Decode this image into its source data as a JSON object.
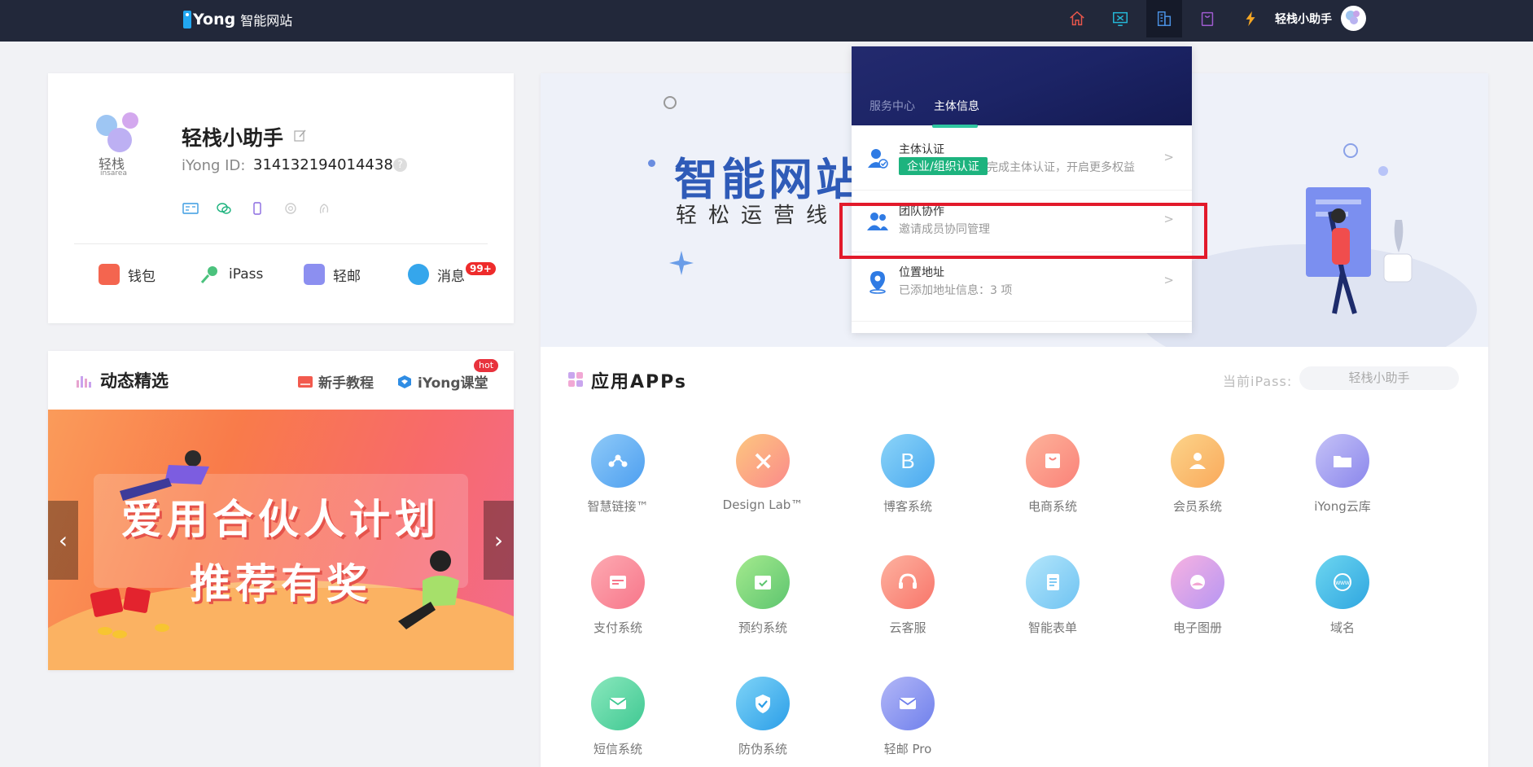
{
  "topbar": {
    "logo_word": "Yong",
    "logo_sub": "智能网站",
    "icons": [
      "home-icon",
      "monitor-icon",
      "building-icon",
      "bag-icon",
      "lightning-icon"
    ],
    "username": "轻栈小助手"
  },
  "profile": {
    "name": "轻栈小助手",
    "logo_text": "轻栈",
    "logo_sub": "insarea",
    "id_label": "iYong ID:",
    "id_value": "3141321940144384",
    "help": "?",
    "links": [
      {
        "label": "钱包"
      },
      {
        "label": "iPass"
      },
      {
        "label": "轻邮"
      },
      {
        "label": "消息"
      }
    ],
    "msg_badge": "99+"
  },
  "dynamic": {
    "title": "动态精选",
    "tutorial": "新手教程",
    "classroom": "iYong课堂",
    "hot": "hot",
    "banner_line1": "爱用合伙人计划",
    "banner_line2": "推荐有奖",
    "prev": "‹",
    "next": "›"
  },
  "hero": {
    "title": "智能网站",
    "subtitle": "轻松运营线"
  },
  "apps": {
    "title": "应用APPs",
    "ipass_label": "当前iPass:",
    "ipass_value": "轻栈小助手",
    "items": [
      {
        "label": "智慧链接™",
        "color": "#6ab7f5"
      },
      {
        "label": "Design Lab™",
        "color": "#fba57a"
      },
      {
        "label": "博客系统",
        "color": "#6dc0f5"
      },
      {
        "label": "电商系统",
        "color": "#fc9a89"
      },
      {
        "label": "会员系统",
        "color": "#f9b96b"
      },
      {
        "label": "iYong云库",
        "color": "#a7a6f2"
      },
      {
        "label": "支付系统",
        "color": "#f98a96"
      },
      {
        "label": "预约系统",
        "color": "#7bd686"
      },
      {
        "label": "云客服",
        "color": "#fb8e82"
      },
      {
        "label": "智能表单",
        "color": "#7fd0f5"
      },
      {
        "label": "电子图册",
        "color": "#f79ad7"
      },
      {
        "label": "域名",
        "color": "#4fc3e8"
      },
      {
        "label": "短信系统",
        "color": "#5fd9a5"
      },
      {
        "label": "防伪系统",
        "color": "#4fc0ee"
      },
      {
        "label": "轻邮 Pro",
        "color": "#8a9af0"
      }
    ]
  },
  "dropdown": {
    "tab_service": "服务中心",
    "tab_entity": "主体信息",
    "items": [
      {
        "title": "主体认证",
        "badge": "企业/组织认证",
        "desc": "完成主体认证，开启更多权益"
      },
      {
        "title": "团队协作",
        "desc": "邀请成员协同管理"
      },
      {
        "title": "位置地址",
        "desc": "已添加地址信息：3 项"
      }
    ],
    "chevron": ">"
  }
}
